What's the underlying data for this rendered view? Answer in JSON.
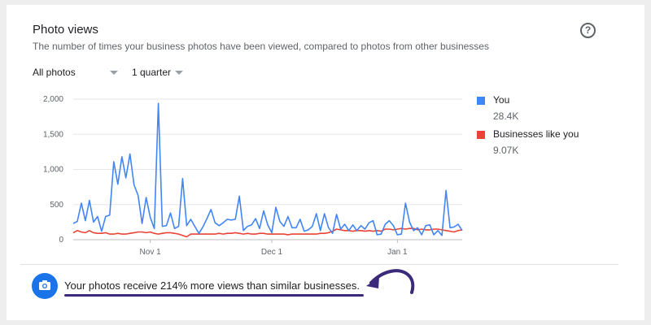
{
  "title": "Photo views",
  "subtitle": "The number of times your business photos have been viewed, compared to photos from other businesses",
  "help_icon": "question-circle-icon",
  "filters": {
    "type": "All photos",
    "period": "1 quarter"
  },
  "legend": [
    {
      "name": "You",
      "value": "28.4K",
      "color": "#4285f4"
    },
    {
      "name": "Businesses like you",
      "value": "9.07K",
      "color": "#ea4335"
    }
  ],
  "insight": {
    "icon": "camera-icon",
    "text": "Your photos receive 214% more views than similar businesses."
  },
  "chart_data": {
    "type": "line",
    "ylim": [
      0,
      2000
    ],
    "yticks": [
      "0",
      "500",
      "1,000",
      "1,500",
      "2,000"
    ],
    "xticks": [
      {
        "label": "Nov 1",
        "index": 19
      },
      {
        "label": "Dec 1",
        "index": 49
      },
      {
        "label": "Jan 1",
        "index": 80
      }
    ],
    "grid": true,
    "legend_position": "right",
    "series": [
      {
        "name": "You",
        "color": "#4285f4",
        "values": [
          230,
          260,
          520,
          270,
          560,
          250,
          330,
          120,
          330,
          350,
          1110,
          790,
          1180,
          880,
          1220,
          780,
          630,
          230,
          600,
          320,
          160,
          1940,
          190,
          200,
          380,
          160,
          190,
          870,
          200,
          290,
          190,
          90,
          180,
          300,
          430,
          240,
          200,
          240,
          290,
          280,
          290,
          620,
          130,
          190,
          210,
          300,
          160,
          410,
          210,
          100,
          460,
          260,
          190,
          330,
          170,
          170,
          290,
          120,
          140,
          190,
          370,
          130,
          370,
          170,
          90,
          360,
          150,
          220,
          130,
          210,
          130,
          200,
          150,
          240,
          270,
          70,
          80,
          220,
          270,
          200,
          70,
          80,
          520,
          250,
          130,
          170,
          70,
          200,
          210,
          70,
          130,
          60,
          700,
          170,
          180,
          220,
          130
        ]
      },
      {
        "name": "Businesses like you",
        "color": "#ea4335",
        "values": [
          100,
          130,
          110,
          100,
          130,
          100,
          90,
          90,
          100,
          80,
          80,
          90,
          80,
          80,
          90,
          100,
          110,
          110,
          100,
          110,
          90,
          80,
          90,
          100,
          100,
          90,
          80,
          60,
          40,
          80,
          80,
          80,
          80,
          80,
          80,
          80,
          90,
          80,
          90,
          90,
          100,
          90,
          80,
          90,
          80,
          80,
          90,
          90,
          80,
          80,
          80,
          80,
          80,
          70,
          80,
          80,
          80,
          80,
          80,
          80,
          80,
          90,
          90,
          100,
          120,
          150,
          140,
          130,
          130,
          120,
          130,
          130,
          120,
          130,
          120,
          130,
          120,
          150,
          150,
          140,
          150,
          160,
          150,
          160,
          160,
          140,
          150,
          140,
          140,
          150,
          150,
          140,
          130,
          120,
          110,
          130,
          140
        ]
      }
    ]
  }
}
